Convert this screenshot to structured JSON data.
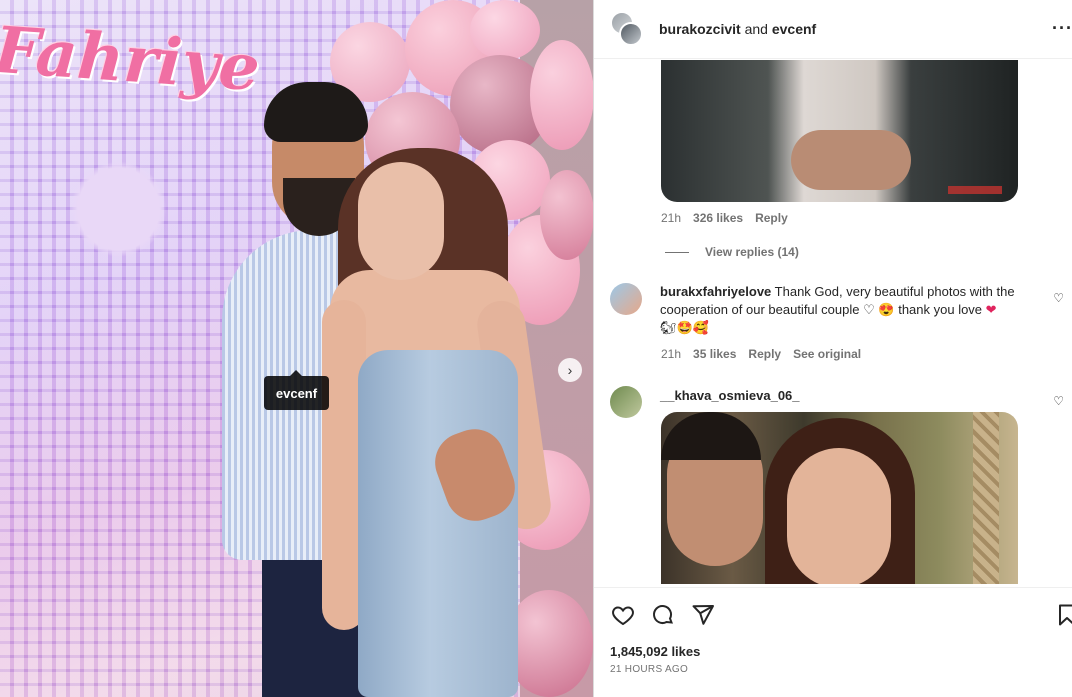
{
  "photo": {
    "sign_text": "Fahriye",
    "tag_label": "evcenf",
    "next_icon": "chevron-right-icon"
  },
  "header": {
    "user1": "burakozcivit",
    "conjunction": "and",
    "user2": "evcenf",
    "more_icon": "more-horizontal-icon"
  },
  "comment1": {
    "time": "21h",
    "likes": "326 likes",
    "reply": "Reply",
    "view_replies": "View replies (14)"
  },
  "comment2": {
    "username": "burakxfahriyelove",
    "text_line1": "Thank God, very beautiful photos with the",
    "text_line2": "cooperation of our beautiful couple",
    "text_tail": "thank you love",
    "time": "21h",
    "likes": "35 likes",
    "reply": "Reply",
    "see_original": "See original"
  },
  "comment3": {
    "username": "__khava_osmieva_06_"
  },
  "post": {
    "likes": "1,845,092 likes",
    "time": "21 HOURS AGO",
    "icons": [
      "heart-icon",
      "comment-icon",
      "share-icon",
      "bookmark-icon"
    ]
  },
  "colors": {
    "text": "#262626",
    "muted": "#737373",
    "red_heart": "#ed4956"
  }
}
